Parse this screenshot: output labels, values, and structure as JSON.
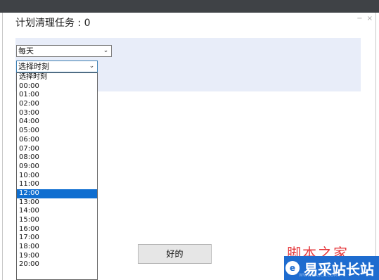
{
  "window": {
    "title": "计划清理任务 : 0"
  },
  "frequency_select": {
    "value": "每天"
  },
  "time_select": {
    "value": "选择时刻",
    "options": [
      "选择时刻",
      "00:00",
      "01:00",
      "02:00",
      "03:00",
      "04:00",
      "05:00",
      "06:00",
      "07:00",
      "08:00",
      "09:00",
      "10:00",
      "11:00",
      "12:00",
      "13:00",
      "14:00",
      "15:00",
      "16:00",
      "17:00",
      "18:00",
      "19:00",
      "20:00"
    ],
    "highlighted": "12:00"
  },
  "buttons": {
    "ok_label": "好的"
  },
  "watermark": {
    "script_text": "脚本之家",
    "logo_text": "易采站长站",
    "small_text": "WWW.EASCK.COM"
  },
  "colors": {
    "panel_bg": "#e8edf9",
    "highlight": "#0f6ed0",
    "titlebar": "#3f4246"
  }
}
